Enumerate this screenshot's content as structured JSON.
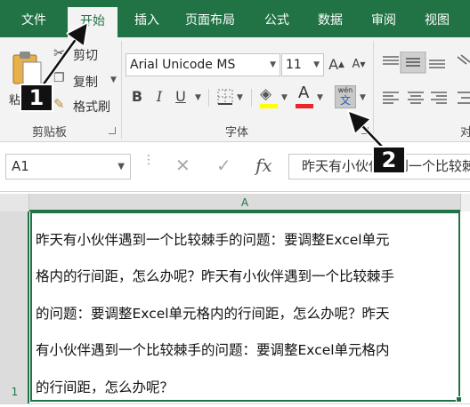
{
  "tabs": [
    "文件",
    "开始",
    "插入",
    "页面布局",
    "公式",
    "数据",
    "审阅",
    "视图"
  ],
  "clipboard": {
    "paste": "粘",
    "cut": "剪切",
    "copy": "复制",
    "format_painter": "格式刷",
    "group": "剪贴板"
  },
  "font": {
    "name": "Arial Unicode MS",
    "size": "11",
    "group": "字体",
    "bold": "B",
    "italic": "I",
    "underline": "U",
    "grow": "A",
    "shrink": "A",
    "font_color": "A",
    "phonetic_top": "wén",
    "phonetic_bottom": "文"
  },
  "align": {
    "group_partial": "对"
  },
  "formula_bar": {
    "name_box": "A1",
    "cancel": "✕",
    "enter": "✓",
    "fx": "fx",
    "content": "昨天有小伙伴遇到一个比较棘手的问题：要调整Excel单元格内的行间距，怎么办呢？"
  },
  "grid": {
    "column": "A",
    "row": "1",
    "lines": [
      "昨天有小伙伴遇到一个比较棘手的问题：要调整Excel单元",
      "格内的行间距，怎么办呢？昨天有小伙伴遇到一个比较棘手",
      "的问题：要调整Excel单元格内的行间距，怎么办呢？昨天",
      "有小伙伴遇到一个比较棘手的问题：要调整Excel单元格内",
      "的行间距，怎么办呢？"
    ]
  },
  "callouts": [
    "1",
    "2"
  ],
  "colors": {
    "accent": "#217346",
    "ribbon_bg": "#f3f3f3",
    "font_color_bar": "#e8262c",
    "highlight_bar": "#ffff00"
  }
}
